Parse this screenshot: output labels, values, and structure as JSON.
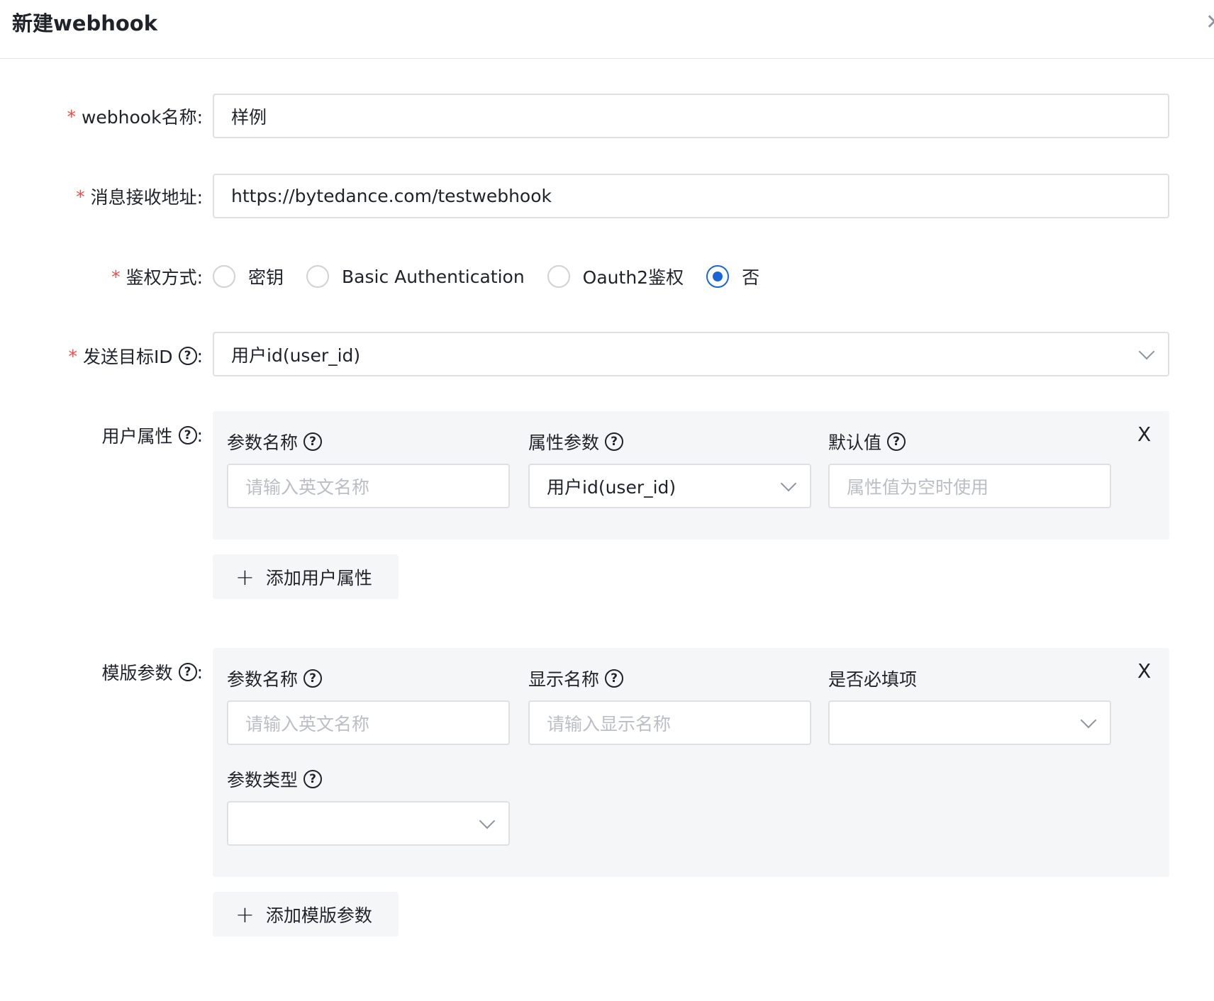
{
  "dialog": {
    "title": "新建webhook"
  },
  "form": {
    "name": {
      "label": "webhook名称:",
      "value": "样例"
    },
    "url": {
      "label": "消息接收地址:",
      "value": "https://bytedance.com/testwebhook"
    },
    "auth": {
      "label": "鉴权方式:",
      "options": [
        "密钥",
        "Basic Authentication",
        "Oauth2鉴权",
        "否"
      ],
      "selected": "否"
    },
    "target": {
      "label": "发送目标ID",
      "value": "用户id(user_id)"
    },
    "user_attrs": {
      "label": "用户属性",
      "columns": [
        "参数名称",
        "属性参数",
        "默认值"
      ],
      "name_placeholder": "请输入英文名称",
      "attr_value": "用户id(user_id)",
      "default_placeholder": "属性值为空时使用",
      "add_label": "添加用户属性"
    },
    "template_params": {
      "label": "模版参数",
      "columns": [
        "参数名称",
        "显示名称",
        "是否必填项"
      ],
      "name_placeholder": "请输入英文名称",
      "display_placeholder": "请输入显示名称",
      "type_label": "参数类型",
      "add_label": "添加模版参数"
    }
  },
  "colors": {
    "accent": "#1a66d6",
    "required": "#f54a45"
  }
}
